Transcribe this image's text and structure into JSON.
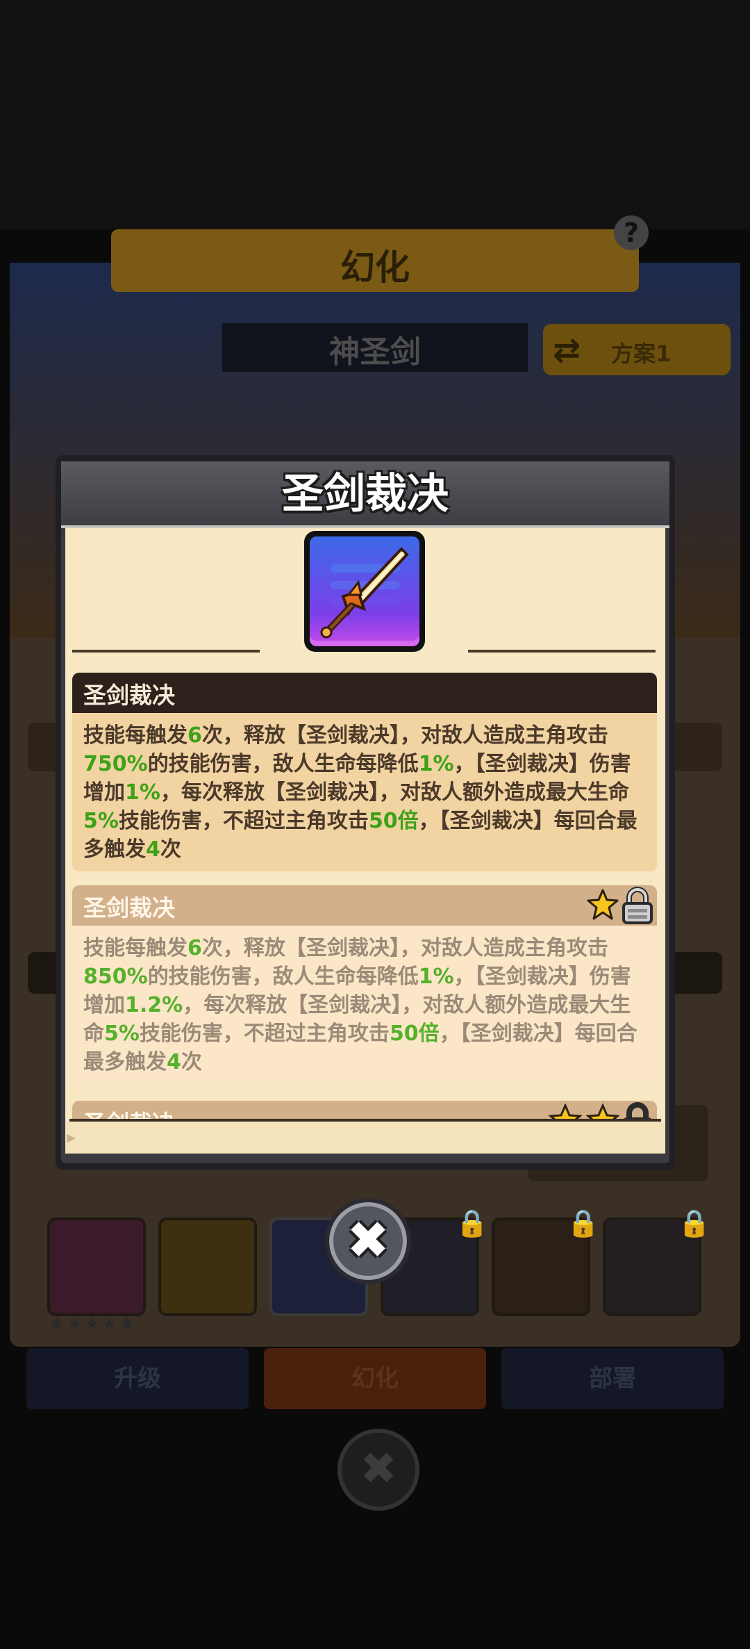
{
  "background": {
    "banner_title": "幻化",
    "help_label": "?",
    "weapon_name": "神圣剑",
    "plan_label": "方案1",
    "tabs": [
      "升级",
      "幻化",
      "部署"
    ],
    "stars": "★★★★★",
    "close_label": "✖"
  },
  "modal": {
    "title": "圣剑裁决",
    "icon": "holy-sword-icon",
    "sections": [
      {
        "title": "圣剑裁决",
        "locked": false,
        "stars": 0,
        "text": [
          "技能每触发",
          "6",
          "次，释放【圣剑裁决】，对敌人造成主角攻击",
          "750%",
          "的技能伤害，敌人生命每降低",
          "1%",
          "，【圣剑裁决】伤害增加",
          "1%",
          "，每次释放【圣剑裁决】，对敌人额外造成最大生命",
          "5%",
          "技能伤害，不超过主角攻击",
          "50倍",
          "，【圣剑裁决】每回合最多触发",
          "4",
          "次"
        ]
      },
      {
        "title": "圣剑裁决",
        "locked": true,
        "stars": 1,
        "text": [
          "技能每触发",
          "6",
          "次，释放【圣剑裁决】，对敌人造成主角攻击",
          "850%",
          "的技能伤害，敌人生命每降低",
          "1%",
          "，【圣剑裁决】伤害增加",
          "1.2%",
          "，每次释放【圣剑裁决】，对敌人额外造成最大生命",
          "5%",
          "技能伤害，不超过主角攻击",
          "50倍",
          "，【圣剑裁决】每回合最多触发",
          "4",
          "次"
        ]
      },
      {
        "title": "圣剑裁决",
        "locked": true,
        "stars": 2
      }
    ],
    "close_label": "✖"
  },
  "colors": {
    "highlight_green": "#3da218",
    "section_dark_header": "#2d211b",
    "section_light_header": "#d2b08a",
    "parchment": "#f8e8c4"
  }
}
